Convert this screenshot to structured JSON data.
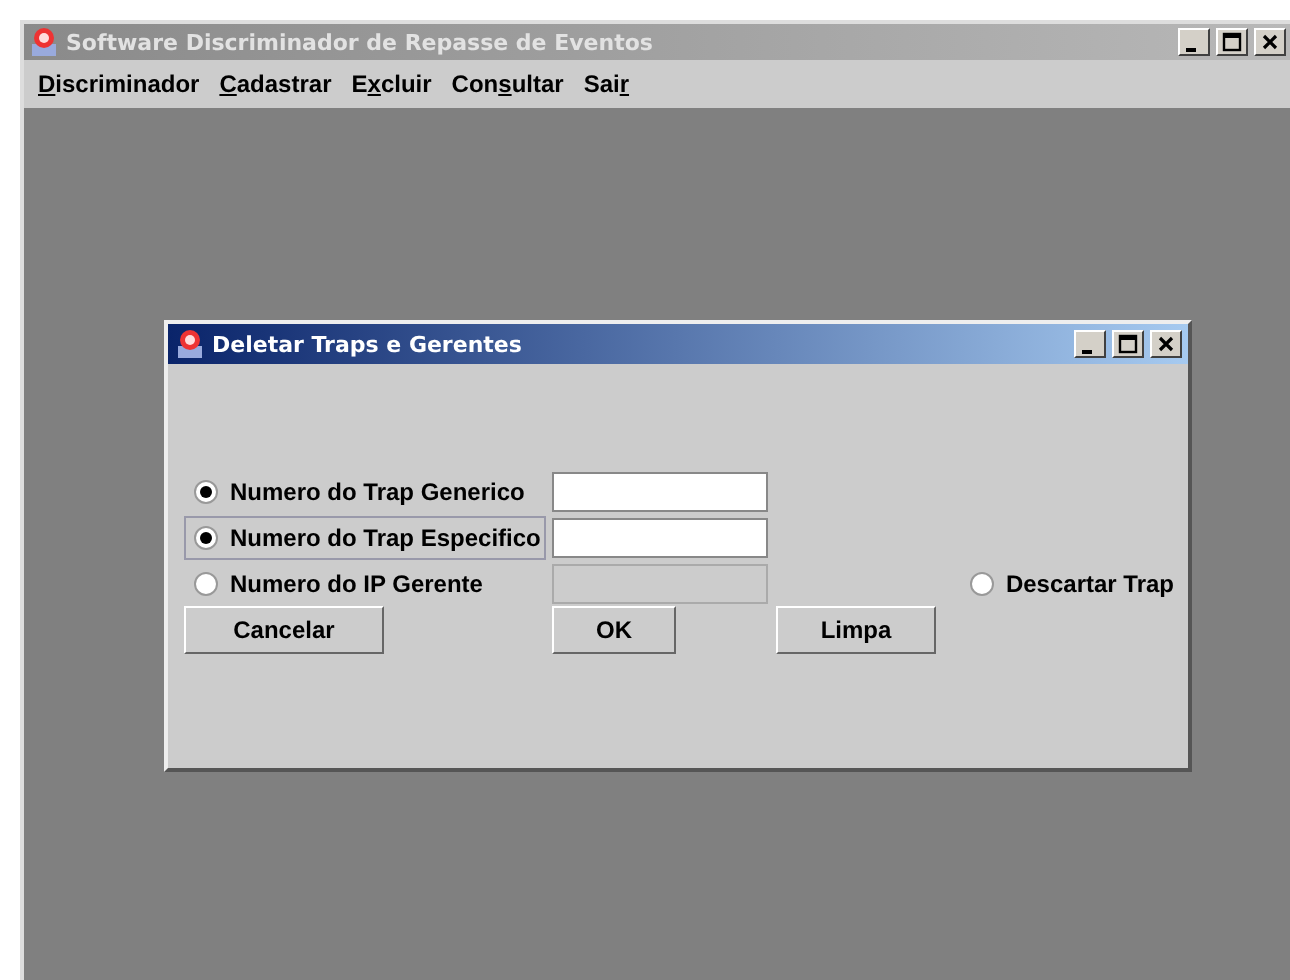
{
  "window": {
    "title": "Software Discriminador de Repasse de Eventos"
  },
  "menu": [
    {
      "mnemonic": "D",
      "after": "iscriminador"
    },
    {
      "mnemonic": "C",
      "after": "adastrar"
    },
    {
      "before": "E",
      "mnemonic": "x",
      "after": "cluir"
    },
    {
      "before": "Con",
      "mnemonic": "s",
      "after": "ultar"
    },
    {
      "before": "Sai",
      "mnemonic": "r"
    }
  ],
  "dialog": {
    "title": "Deletar Traps e Gerentes",
    "options": [
      {
        "label": "Numero do Trap Generico",
        "selected": true,
        "focused": false,
        "field": {
          "disabled": false
        }
      },
      {
        "label": "Numero do Trap Especifico",
        "selected": true,
        "focused": true,
        "field": {
          "disabled": false
        }
      },
      {
        "label": "Numero do IP Gerente",
        "selected": false,
        "focused": false,
        "field": {
          "disabled": true
        }
      }
    ],
    "discard": {
      "label": "Descartar Trap",
      "selected": false
    },
    "buttons": [
      "Cancelar",
      "OK",
      "Limpa"
    ]
  }
}
